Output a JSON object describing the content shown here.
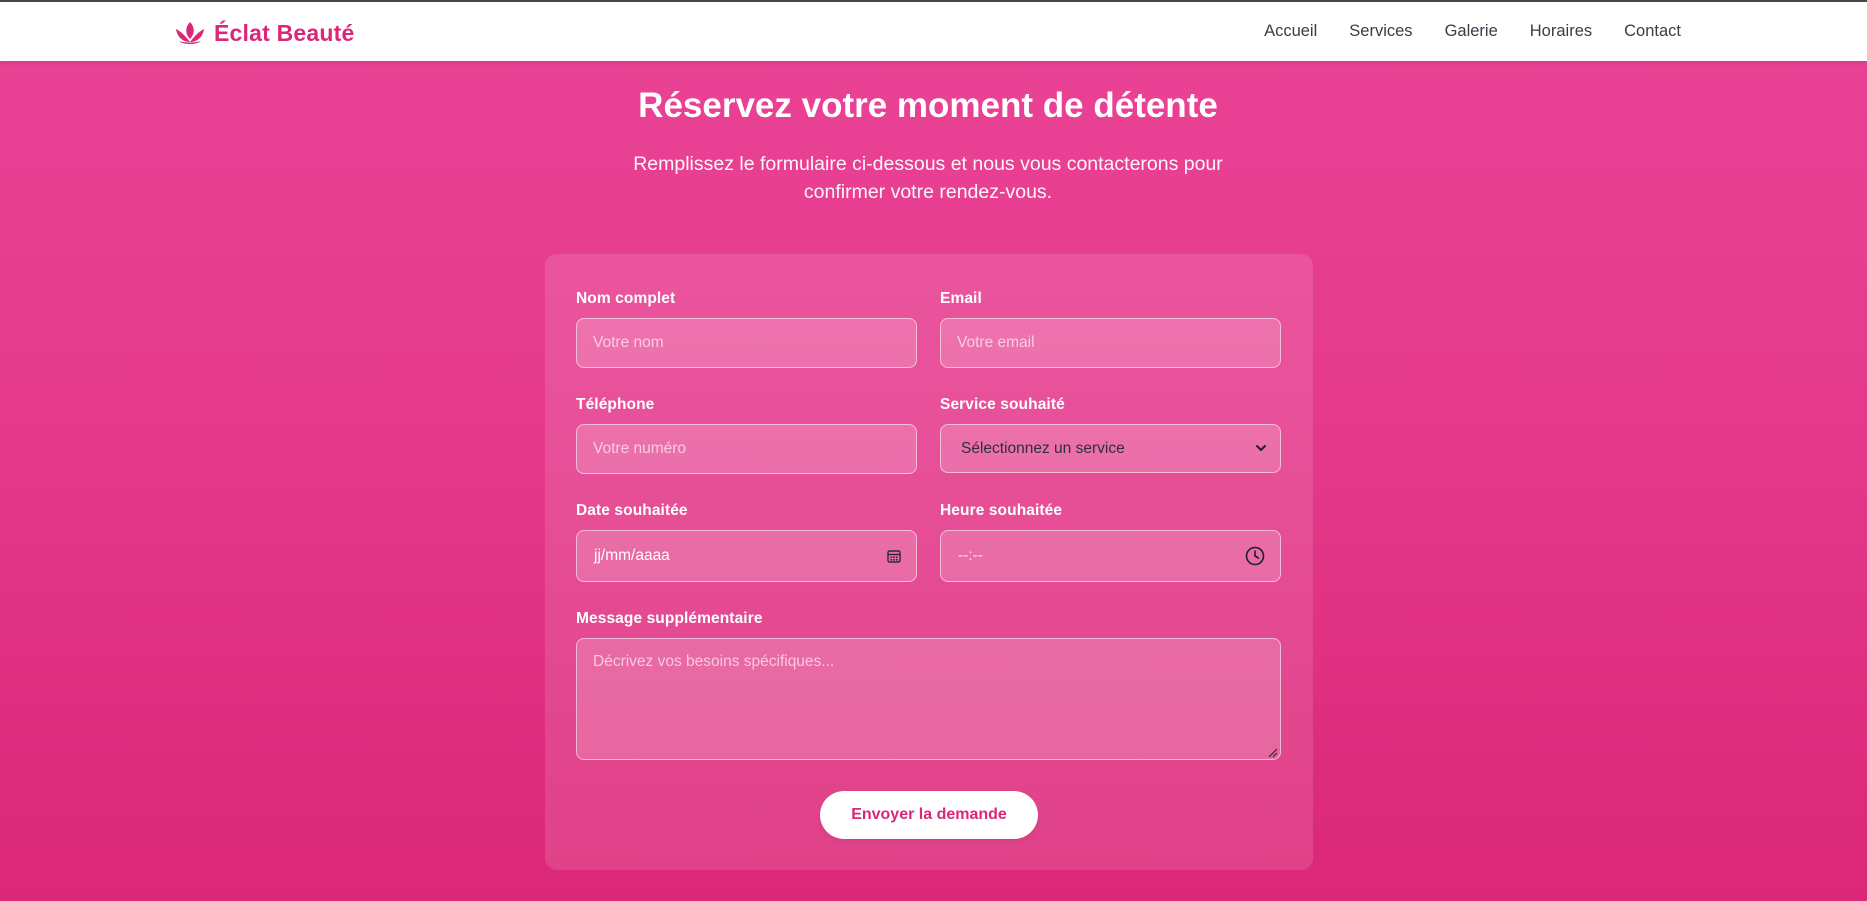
{
  "brand": {
    "name": "Éclat Beauté",
    "icon": "lotus-icon",
    "color": "#db2777"
  },
  "nav": {
    "items": [
      "Accueil",
      "Services",
      "Galerie",
      "Horaires",
      "Contact"
    ]
  },
  "hero": {
    "title": "Réservez votre moment de détente",
    "subtitle": "Remplissez le formulaire ci-dessous et nous vous contacterons pour confirmer votre rendez-vous."
  },
  "form": {
    "name": {
      "label": "Nom complet",
      "placeholder": "Votre nom",
      "value": ""
    },
    "email": {
      "label": "Email",
      "placeholder": "Votre email",
      "value": ""
    },
    "phone": {
      "label": "Téléphone",
      "placeholder": "Votre numéro",
      "value": ""
    },
    "service": {
      "label": "Service souhaité",
      "selected": "Sélectionnez un service"
    },
    "date": {
      "label": "Date souhaitée",
      "value": "jj/mm/aaaa",
      "icon": "calendar-icon"
    },
    "time": {
      "label": "Heure souhaitée",
      "value": "--:--",
      "icon": "clock-icon"
    },
    "message": {
      "label": "Message supplémentaire",
      "placeholder": "Décrivez vos besoins spécifiques...",
      "value": ""
    },
    "submit_label": "Envoyer la demande"
  },
  "colors": {
    "accent": "#db2777",
    "background_top": "#ea4396",
    "background_bottom": "#db2777"
  }
}
